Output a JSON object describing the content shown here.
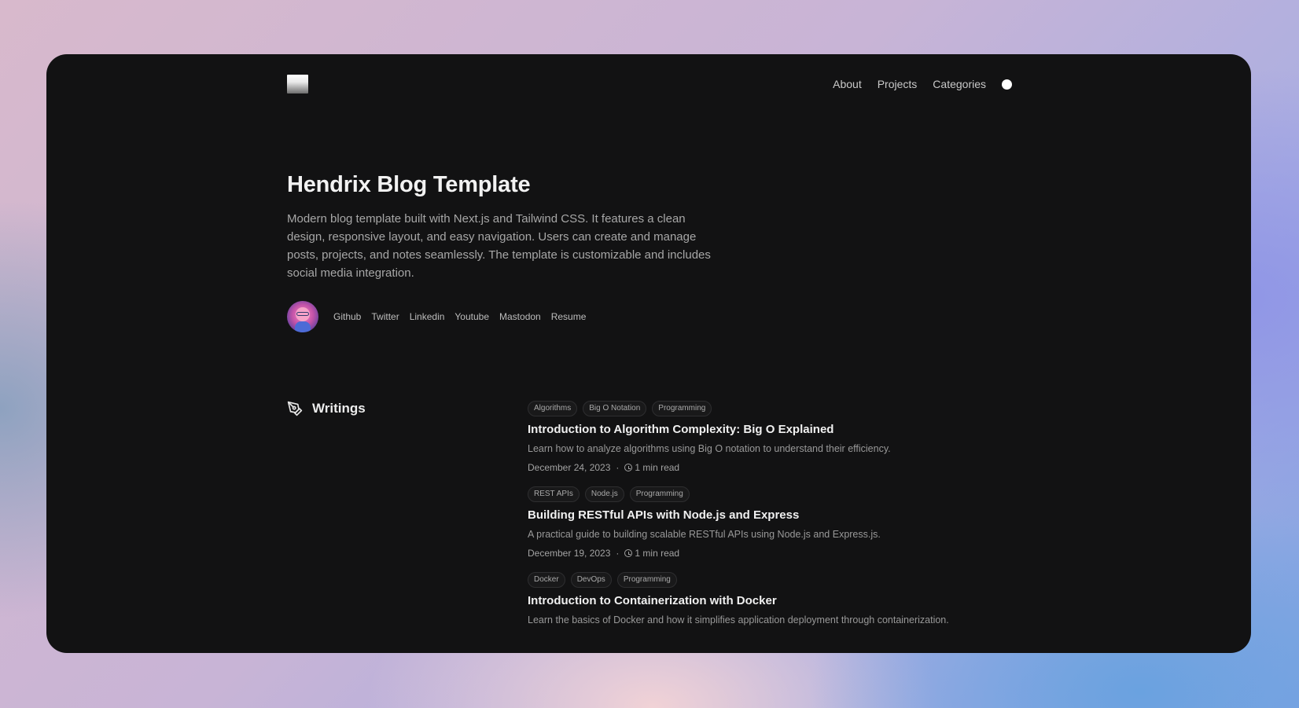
{
  "nav": {
    "items": [
      {
        "label": "About"
      },
      {
        "label": "Projects"
      },
      {
        "label": "Categories"
      }
    ],
    "theme_toggle": "theme-toggle-dot"
  },
  "hero": {
    "title": "Hendrix Blog Template",
    "description": "Modern blog template built with Next.js and Tailwind CSS. It features a clean design, responsive layout, and easy navigation. Users can create and manage posts, projects, and notes seamlessly. The template is customizable and includes social media integration.",
    "social_links": [
      {
        "label": "Github"
      },
      {
        "label": "Twitter"
      },
      {
        "label": "Linkedin"
      },
      {
        "label": "Youtube"
      },
      {
        "label": "Mastodon"
      },
      {
        "label": "Resume"
      }
    ]
  },
  "writings": {
    "heading": "Writings",
    "icon": "pen-icon",
    "posts": [
      {
        "tags": [
          "Algorithms",
          "Big O Notation",
          "Programming"
        ],
        "title": "Introduction to Algorithm Complexity: Big O Explained",
        "description": "Learn how to analyze algorithms using Big O notation to understand their efficiency.",
        "date": "December 24, 2023",
        "separator": "·",
        "read_time": "1 min read"
      },
      {
        "tags": [
          "REST APIs",
          "Node.js",
          "Programming"
        ],
        "title": "Building RESTful APIs with Node.js and Express",
        "description": "A practical guide to building scalable RESTful APIs using Node.js and Express.js.",
        "date": "December 19, 2023",
        "separator": "·",
        "read_time": "1 min read"
      },
      {
        "tags": [
          "Docker",
          "DevOps",
          "Programming"
        ],
        "title": "Introduction to Containerization with Docker",
        "description": "Learn the basics of Docker and how it simplifies application deployment through containerization.",
        "date": "",
        "separator": "",
        "read_time": ""
      }
    ]
  },
  "colors": {
    "window_bg": "#121213",
    "text_primary": "#f0f0f0",
    "text_muted": "#a7a7a7"
  }
}
